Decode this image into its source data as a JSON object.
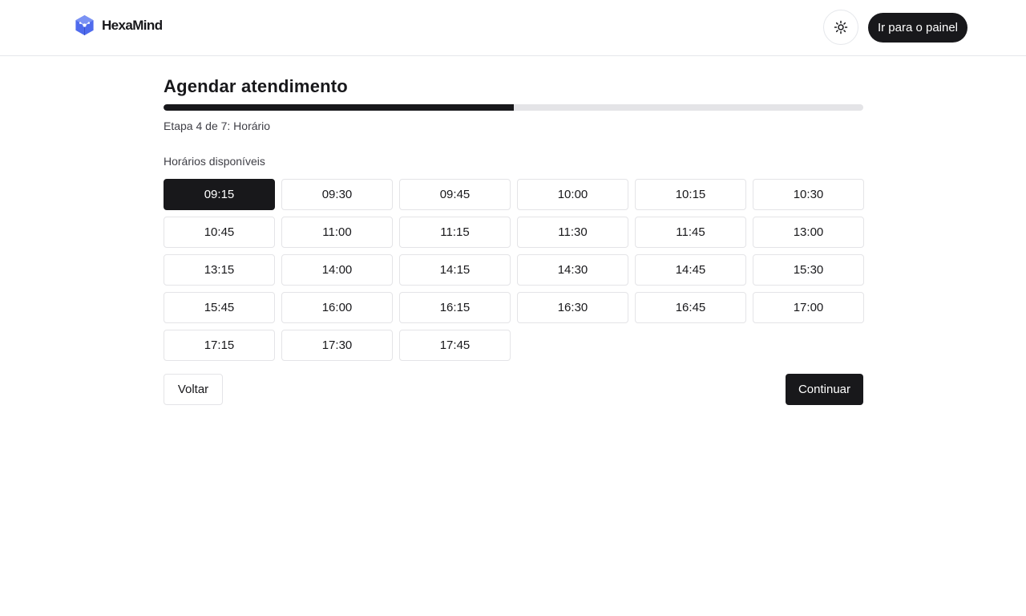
{
  "header": {
    "brand": "HexaMind",
    "logo_icon": "hexagon-cube-icon",
    "theme_icon": "sun-icon",
    "dashboard_label": "Ir para o painel"
  },
  "wizard": {
    "title": "Agendar atendimento",
    "step_current": 4,
    "step_total": 7,
    "progress_fraction": 0.5,
    "step_label": "Etapa 4 de 7: Horário"
  },
  "slots": {
    "label": "Horários disponíveis",
    "selected": "09:15",
    "times": [
      "09:15",
      "09:30",
      "09:45",
      "10:00",
      "10:15",
      "10:30",
      "10:45",
      "11:00",
      "11:15",
      "11:30",
      "11:45",
      "13:00",
      "13:15",
      "14:00",
      "14:15",
      "14:30",
      "14:45",
      "15:30",
      "15:45",
      "16:00",
      "16:15",
      "16:30",
      "16:45",
      "17:00",
      "17:15",
      "17:30",
      "17:45"
    ]
  },
  "actions": {
    "back_label": "Voltar",
    "continue_label": "Continuar"
  },
  "colors": {
    "primary": "#18181b",
    "logo_blue": "#4f6bed",
    "border": "#e4e4e7",
    "track": "#e4e4e7"
  }
}
